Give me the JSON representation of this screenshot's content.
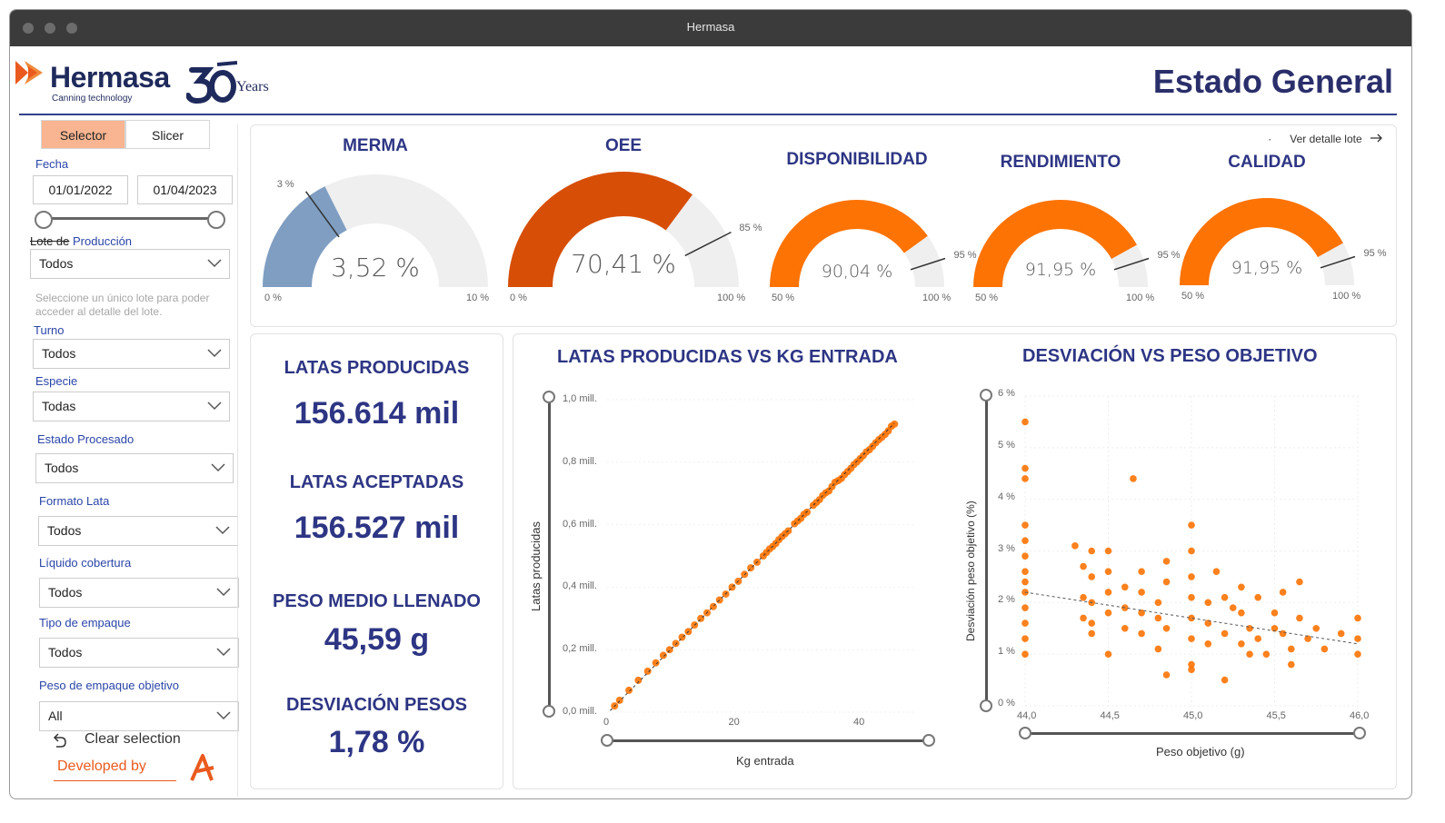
{
  "window": {
    "title": "Hermasa"
  },
  "header": {
    "brand": "Hermasa",
    "tagline": "Canning technology",
    "years": "Years",
    "page_title": "Estado General"
  },
  "sidebar": {
    "toggle": {
      "selector": "Selector",
      "slicer": "Slicer"
    },
    "fecha": {
      "label": "Fecha",
      "from": "01/01/2022",
      "to": "01/04/2023"
    },
    "lote": {
      "label_struck": "Lote de",
      "label": "Producción",
      "value": "Todos",
      "hint": "Seleccione un único lote para poder acceder al detalle del lote."
    },
    "turno": {
      "label": "Turno",
      "value": "Todos"
    },
    "especie": {
      "label": "Especie",
      "value": "Todas"
    },
    "estado": {
      "label": "Estado Procesado",
      "value": "Todos"
    },
    "formato": {
      "label": "Formato Lata",
      "value": "Todos"
    },
    "liquido": {
      "label": "Líquido cobertura",
      "value": "Todos"
    },
    "empaque": {
      "label": "Tipo de empaque",
      "value": "Todos"
    },
    "peso": {
      "label": "Peso de empaque objetivo",
      "value": "All"
    },
    "clear": "Clear selection",
    "developed_by": "Developed by"
  },
  "gauges": {
    "ver_detalle": "Ver detalle lote",
    "items": [
      {
        "title": "MERMA",
        "value": "3,52 %",
        "min": "0 %",
        "max": "10 %",
        "target": "3 %",
        "fraction": 0.352,
        "color": "#7f9ec2"
      },
      {
        "title": "OEE",
        "value": "70,41 %",
        "min": "0 %",
        "max": "100 %",
        "target": "85 %",
        "fraction": 0.7041,
        "color": "#d74e07"
      },
      {
        "title": "DISPONIBILIDAD",
        "value": "90,04 %",
        "min": "50 %",
        "max": "100 %",
        "target": "95 %",
        "fraction": 0.8008,
        "color": "#fd7304"
      },
      {
        "title": "RENDIMIENTO",
        "value": "91,95 %",
        "min": "50 %",
        "max": "100 %",
        "target": "95 %",
        "fraction": 0.839,
        "color": "#fd7304"
      },
      {
        "title": "CALIDAD",
        "value": "91,95 %",
        "min": "50 %",
        "max": "100 %",
        "target": "95 %",
        "fraction": 0.839,
        "color": "#fd7304"
      }
    ]
  },
  "kpis": [
    {
      "title": "LATAS PRODUCIDAS",
      "value": "156.614 mil"
    },
    {
      "title": "LATAS ACEPTADAS",
      "value": "156.527 mil"
    },
    {
      "title": "PESO MEDIO LLENADO",
      "value": "45,59 g"
    },
    {
      "title": "DESVIACIÓN PESOS",
      "value": "1,78 %"
    }
  ],
  "colors": {
    "accent": "#fd7304",
    "navy": "#2d3584",
    "link": "#2a45a8"
  },
  "chart_data": [
    {
      "type": "scatter",
      "title": "LATAS PRODUCIDAS VS KG ENTRADA",
      "xlabel": "Kg entrada",
      "ylabel": "Latas producidas",
      "xlim": [
        0,
        48
      ],
      "ylim": [
        0,
        1000000
      ],
      "x_ticks": [
        "0",
        "20",
        "40"
      ],
      "y_ticks": [
        "0,0 mill.",
        "0,2 mill.",
        "0,4 mill.",
        "0,6 mill.",
        "0,8 mill.",
        "1,0 mill."
      ],
      "trendline": true,
      "points": [
        [
          1.2,
          20000
        ],
        [
          2.0,
          38000
        ],
        [
          3.5,
          70000
        ],
        [
          5.0,
          102000
        ],
        [
          6.5,
          131000
        ],
        [
          7.8,
          158000
        ],
        [
          9.0,
          182000
        ],
        [
          10.0,
          200000
        ],
        [
          11.0,
          220000
        ],
        [
          12.0,
          240000
        ],
        [
          13.0,
          258000
        ],
        [
          14.0,
          279000
        ],
        [
          15.0,
          300000
        ],
        [
          16.0,
          318000
        ],
        [
          17.0,
          338000
        ],
        [
          18.0,
          359000
        ],
        [
          19.0,
          378000
        ],
        [
          20.0,
          400000
        ],
        [
          21.0,
          419000
        ],
        [
          22.0,
          441000
        ],
        [
          23.0,
          462000
        ],
        [
          24.0,
          480000
        ],
        [
          25.0,
          500000
        ],
        [
          26.0,
          522000
        ],
        [
          27.0,
          540000
        ],
        [
          28.0,
          562000
        ],
        [
          29.0,
          580000
        ],
        [
          30.0,
          603000
        ],
        [
          31.0,
          620000
        ],
        [
          32.0,
          640000
        ],
        [
          33.0,
          662000
        ],
        [
          34.0,
          680000
        ],
        [
          35.0,
          702000
        ],
        [
          36.0,
          722000
        ],
        [
          37.0,
          741000
        ],
        [
          38.0,
          760000
        ],
        [
          39.0,
          780000
        ],
        [
          40.0,
          801000
        ],
        [
          41.0,
          821000
        ],
        [
          42.0,
          840000
        ],
        [
          43.0,
          862000
        ],
        [
          44.0,
          880000
        ],
        [
          45.0,
          900000
        ],
        [
          45.5,
          915000
        ],
        [
          46.0,
          922000
        ],
        [
          35.5,
          708000
        ],
        [
          36.5,
          736000
        ],
        [
          37.5,
          748000
        ],
        [
          38.5,
          770000
        ],
        [
          39.5,
          792000
        ],
        [
          40.5,
          811000
        ],
        [
          41.5,
          833000
        ],
        [
          42.5,
          851000
        ],
        [
          43.5,
          872000
        ],
        [
          44.5,
          889000
        ],
        [
          33.5,
          671000
        ],
        [
          34.5,
          693000
        ],
        [
          30.5,
          612000
        ],
        [
          31.5,
          633000
        ],
        [
          25.5,
          511000
        ],
        [
          26.5,
          530000
        ],
        [
          27.5,
          552000
        ],
        [
          28.5,
          571000
        ]
      ]
    },
    {
      "type": "scatter",
      "title": "DESVIACIÓN VS PESO OBJETIVO",
      "xlabel": "Peso objetivo (g)",
      "ylabel": "Desviación peso objetivo (%)",
      "xlim": [
        44.0,
        46.0
      ],
      "ylim": [
        0,
        6
      ],
      "x_ticks": [
        "44,0",
        "44,5",
        "45,0",
        "45,5",
        "46,0"
      ],
      "y_ticks": [
        "0 %",
        "1 %",
        "2 %",
        "3 %",
        "4 %",
        "5 %",
        "6 %"
      ],
      "trendline": true,
      "points": [
        [
          44.0,
          5.5
        ],
        [
          44.0,
          4.6
        ],
        [
          44.0,
          4.4
        ],
        [
          44.0,
          3.5
        ],
        [
          44.0,
          3.2
        ],
        [
          44.0,
          2.9
        ],
        [
          44.0,
          2.6
        ],
        [
          44.0,
          2.4
        ],
        [
          44.0,
          2.2
        ],
        [
          44.0,
          1.9
        ],
        [
          44.0,
          1.6
        ],
        [
          44.0,
          1.3
        ],
        [
          44.0,
          1.0
        ],
        [
          44.3,
          3.1
        ],
        [
          44.35,
          2.7
        ],
        [
          44.35,
          2.1
        ],
        [
          44.35,
          1.7
        ],
        [
          44.4,
          3.0
        ],
        [
          44.4,
          2.5
        ],
        [
          44.4,
          2.0
        ],
        [
          44.4,
          1.6
        ],
        [
          44.4,
          1.4
        ],
        [
          44.5,
          3.0
        ],
        [
          44.5,
          2.6
        ],
        [
          44.5,
          2.2
        ],
        [
          44.5,
          1.8
        ],
        [
          44.5,
          1.0
        ],
        [
          44.6,
          2.3
        ],
        [
          44.6,
          1.9
        ],
        [
          44.6,
          1.5
        ],
        [
          44.65,
          4.4
        ],
        [
          44.7,
          2.6
        ],
        [
          44.7,
          2.2
        ],
        [
          44.7,
          1.8
        ],
        [
          44.7,
          1.4
        ],
        [
          44.8,
          2.0
        ],
        [
          44.8,
          1.7
        ],
        [
          44.8,
          1.1
        ],
        [
          44.85,
          2.8
        ],
        [
          44.85,
          2.4
        ],
        [
          44.85,
          1.5
        ],
        [
          44.85,
          0.6
        ],
        [
          45.0,
          3.5
        ],
        [
          45.0,
          3.0
        ],
        [
          45.0,
          2.5
        ],
        [
          45.0,
          2.1
        ],
        [
          45.0,
          1.7
        ],
        [
          45.0,
          1.3
        ],
        [
          45.0,
          0.8
        ],
        [
          45.0,
          0.7
        ],
        [
          45.1,
          2.0
        ],
        [
          45.1,
          1.6
        ],
        [
          45.1,
          1.2
        ],
        [
          45.15,
          2.6
        ],
        [
          45.2,
          2.1
        ],
        [
          45.2,
          1.4
        ],
        [
          45.2,
          0.5
        ],
        [
          45.25,
          1.9
        ],
        [
          45.3,
          2.3
        ],
        [
          45.3,
          1.8
        ],
        [
          45.3,
          1.2
        ],
        [
          45.35,
          1.5
        ],
        [
          45.35,
          1.0
        ],
        [
          45.4,
          2.1
        ],
        [
          45.4,
          1.3
        ],
        [
          45.45,
          1.0
        ],
        [
          45.5,
          1.8
        ],
        [
          45.5,
          1.5
        ],
        [
          45.55,
          2.2
        ],
        [
          45.55,
          1.4
        ],
        [
          45.6,
          1.1
        ],
        [
          45.6,
          0.8
        ],
        [
          45.65,
          2.4
        ],
        [
          45.65,
          1.7
        ],
        [
          45.7,
          1.3
        ],
        [
          45.75,
          1.5
        ],
        [
          45.8,
          1.1
        ],
        [
          45.9,
          1.4
        ],
        [
          46.0,
          1.7
        ],
        [
          46.0,
          1.3
        ],
        [
          46.0,
          1.0
        ]
      ]
    }
  ]
}
